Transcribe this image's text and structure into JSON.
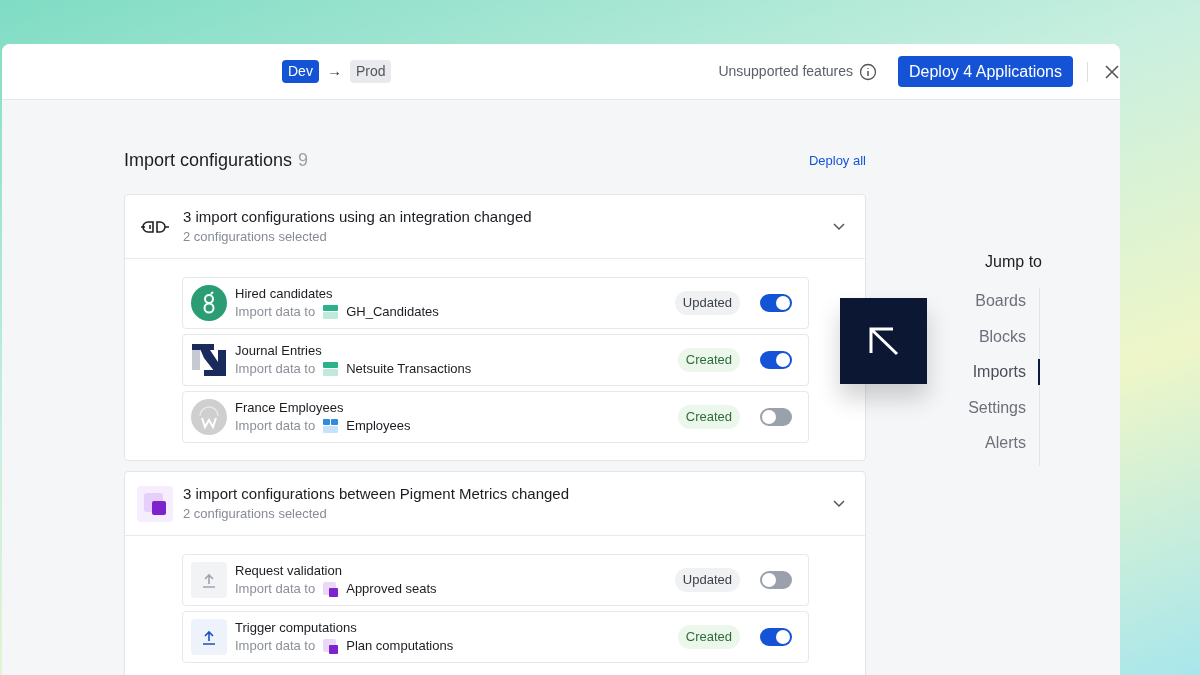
{
  "header": {
    "source_env": "Dev",
    "arrow": "→",
    "target_env": "Prod",
    "unsupported_label": "Unsupported features",
    "deploy_button": "Deploy 4 Applications"
  },
  "section": {
    "title": "Import configurations",
    "count": "9",
    "deploy_all": "Deploy all"
  },
  "groups": [
    {
      "kind": "integration",
      "title": "3 import configurations using an integration changed",
      "subtitle": "2 configurations selected",
      "expanded": true,
      "items": [
        {
          "logo": {
            "kind": "greenhouse"
          },
          "name": "Hired candidates",
          "prefix": "Import data to",
          "target_icon": {
            "kind": "tablegreen"
          },
          "target": "GH_Candidates",
          "status": {
            "kind": "updated",
            "label": "Updated"
          },
          "on": true
        },
        {
          "logo": {
            "kind": "netsuite"
          },
          "name": "Journal Entries",
          "prefix": "Import data to",
          "target_icon": {
            "kind": "tablegreen"
          },
          "target": "Netsuite Transactions",
          "status": {
            "kind": "created",
            "label": "Created"
          },
          "on": true
        },
        {
          "logo": {
            "kind": "workday"
          },
          "name": "France Employees",
          "prefix": "Import data to",
          "target_icon": {
            "kind": "tableblue"
          },
          "target": "Employees",
          "status": {
            "kind": "created",
            "label": "Created"
          },
          "on": false
        }
      ]
    },
    {
      "kind": "metrics",
      "title": "3 import configurations between Pigment Metrics changed",
      "subtitle": "2 configurations selected",
      "expanded": true,
      "items": [
        {
          "logo": {
            "kind": "uploadgray"
          },
          "name": "Request validation",
          "prefix": "Import data to",
          "target_icon": {
            "kind": "metric"
          },
          "target": "Approved seats",
          "status": {
            "kind": "updated",
            "label": "Updated"
          },
          "on": false
        },
        {
          "logo": {
            "kind": "uploadblue"
          },
          "name": "Trigger computations",
          "prefix": "Import data to",
          "target_icon": {
            "kind": "metric"
          },
          "target": "Plan computations",
          "status": {
            "kind": "created",
            "label": "Created"
          },
          "on": true
        }
      ]
    }
  ],
  "jump_to": {
    "title": "Jump to",
    "items": [
      {
        "label": "Boards",
        "selected": false
      },
      {
        "label": "Blocks",
        "selected": false
      },
      {
        "label": "Imports",
        "selected": true
      },
      {
        "label": "Settings",
        "selected": false
      },
      {
        "label": "Alerts",
        "selected": false
      }
    ]
  }
}
